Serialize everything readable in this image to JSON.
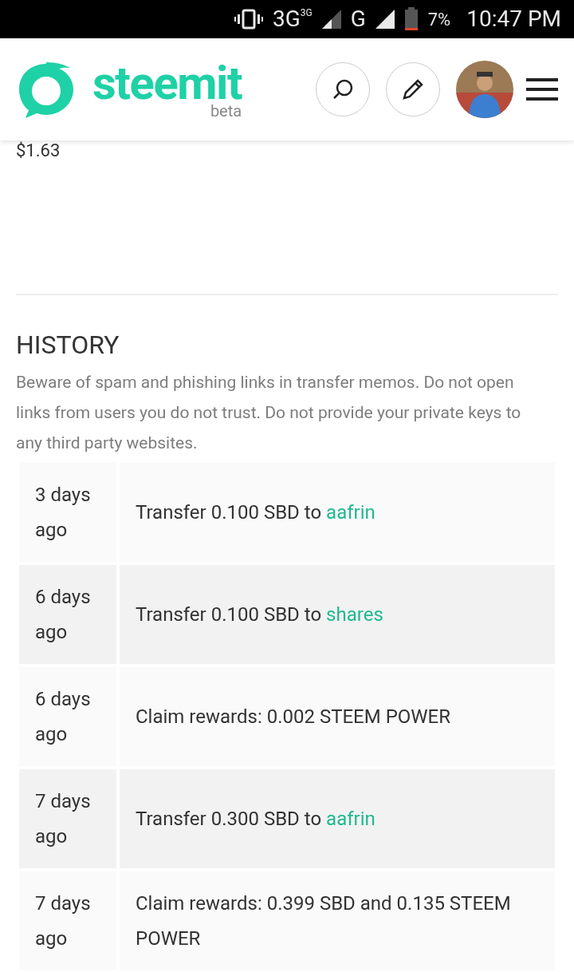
{
  "status_bar": {
    "network": "3G",
    "network_small": "3G",
    "network2": "G",
    "battery": "7%",
    "time": "10:47 PM"
  },
  "header": {
    "logo_text": "steemit",
    "logo_sub": "beta"
  },
  "balance": "$1.63",
  "history": {
    "title": "HISTORY",
    "warning": "Beware of spam and phishing links in transfer memos. Do not open links from users you do not trust. Do not provide your private keys to any third party websites.",
    "rows": [
      {
        "date": "3 days ago",
        "text": "Transfer 0.100 SBD to ",
        "link": "aafrin"
      },
      {
        "date": "6 days ago",
        "text": "Transfer 0.100 SBD to ",
        "link": "shares"
      },
      {
        "date": "6 days ago",
        "text": "Claim rewards: 0.002 STEEM POWER"
      },
      {
        "date": "7 days ago",
        "text": "Transfer 0.300 SBD to ",
        "link": "aafrin"
      },
      {
        "date": "7 days ago",
        "text": "Claim rewards: 0.399 SBD and 0.135 STEEM POWER"
      }
    ]
  }
}
